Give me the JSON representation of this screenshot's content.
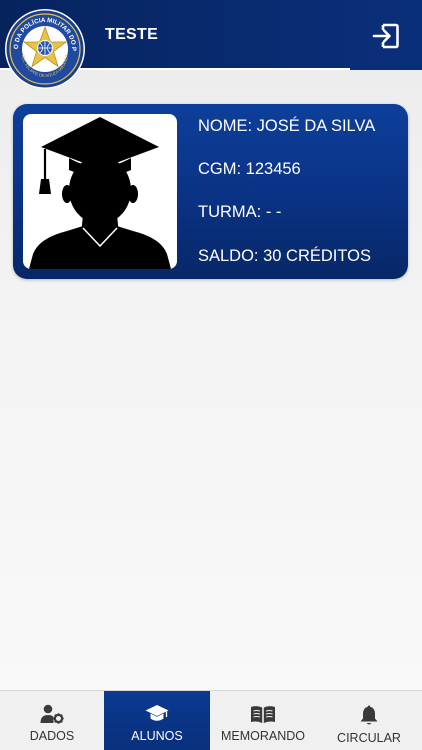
{
  "header": {
    "title": "TESTE",
    "logo_text_top": "COLÉGIO DA POLÍCIA MILITAR DO PARANÁ",
    "logo_text_bottom": "CEL. FELIPPE DE SOUZA MIRANDA",
    "logout_icon": "logout-icon"
  },
  "student": {
    "name": "NOME: JOSÉ DA SILVA",
    "cgm": "CGM: 123456",
    "turma": "TURMA: - -",
    "saldo": "SALDO: 30 CRÉDITOS",
    "photo_icon": "graduate-silhouette-icon"
  },
  "tabs": [
    {
      "label": "DADOS",
      "icon": "user-gear-icon",
      "active": false
    },
    {
      "label": "ALUNOS",
      "icon": "graduation-cap-icon",
      "active": true
    },
    {
      "label": "MEMORANDO",
      "icon": "book-open-icon",
      "active": false
    },
    {
      "label": "CIRCULAR",
      "icon": "bell-icon",
      "active": false
    }
  ],
  "colors": {
    "primary": "#0a2f7a",
    "card": "#0a3284",
    "logo_gold": "#e8c14a"
  }
}
